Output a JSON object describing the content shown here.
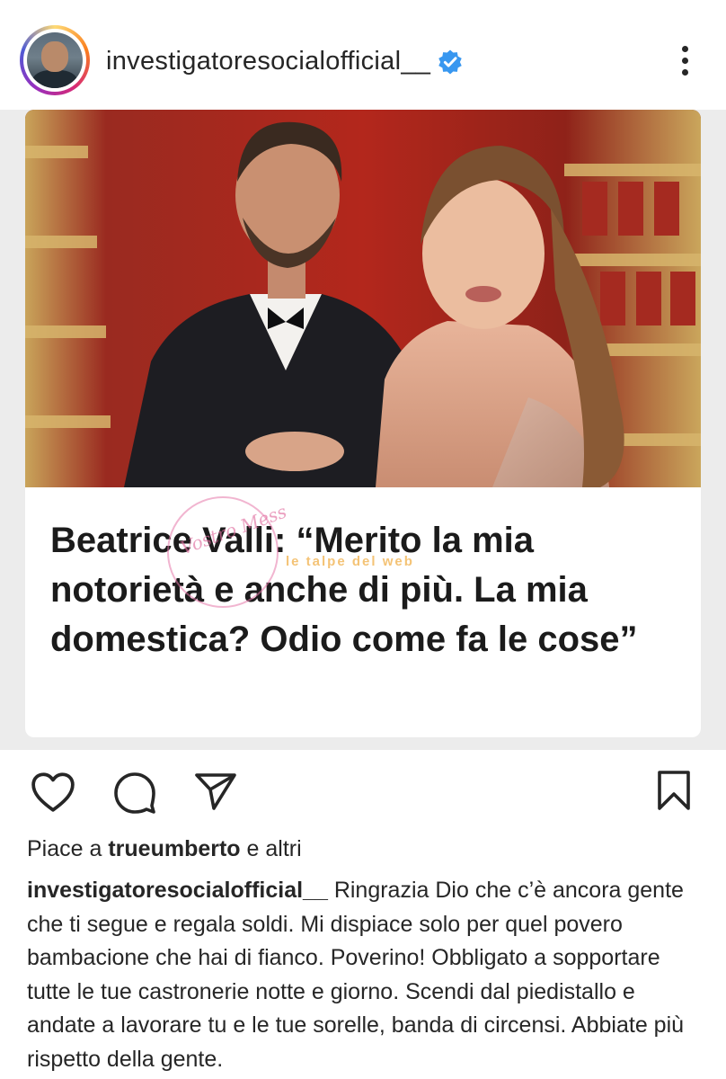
{
  "header": {
    "username": "investigatoresocialofficial__",
    "verified": true,
    "more_icon": "more-vertical-icon"
  },
  "post": {
    "headline": "Beatrice Valli: “Merito la mia notorietà e anche di più. La mia domestica? Odio come fa le cose”",
    "watermarks": [
      "Vostro Mess",
      "le talpe del web"
    ]
  },
  "actions": {
    "like_icon": "heart-icon",
    "comment_icon": "comment-icon",
    "share_icon": "send-icon",
    "save_icon": "bookmark-icon"
  },
  "likes": {
    "prefix": "Piace a",
    "user": "trueumberto",
    "suffix": "e altri"
  },
  "caption": {
    "user": "investigatoresocialofficial__",
    "text": "Ringrazia Dio che c’è ancora gente che ti segue e regala soldi. Mi dispiace solo per quel povero bambacione che hai di fianco. Poverino! Obbligato a sopportare tutte le tue castronerie notte e giorno. Scendi dal piedistallo e andate a lavorare tu e le tue sorelle, banda di circensi. Abbiate più rispetto della gente."
  },
  "colors": {
    "verified_blue": "#3897f0",
    "text": "#262626",
    "theater_red": "#8a2a22",
    "gold": "#c9a45a"
  }
}
